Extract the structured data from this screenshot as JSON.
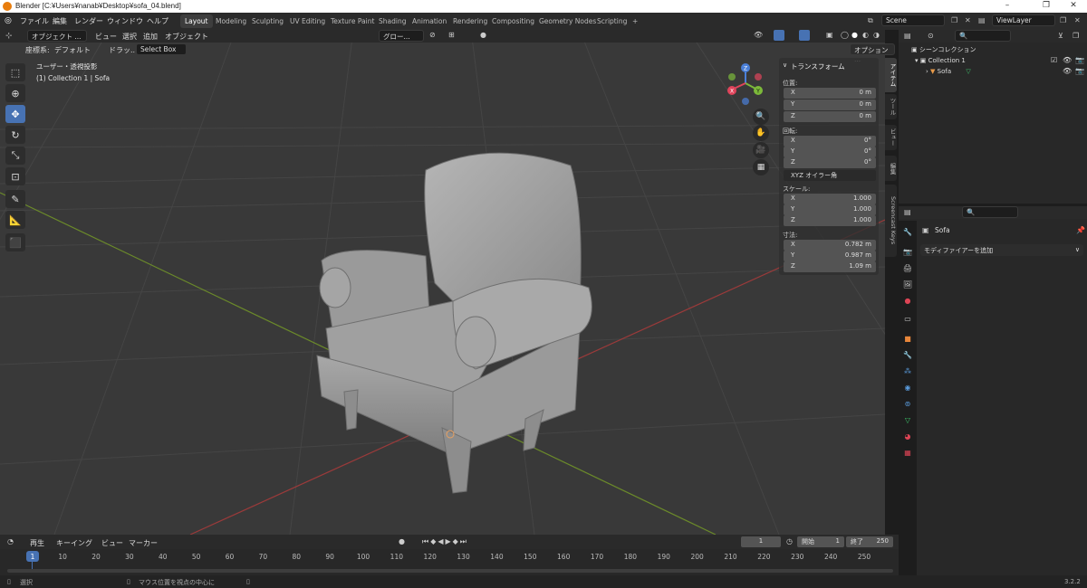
{
  "window": {
    "title": "Blender [C:¥Users¥nanab¥Desktop¥sofa_04.blend]",
    "min": "–",
    "max": "❐",
    "close": "✕"
  },
  "menu": [
    "ファイル",
    "編集",
    "レンダー",
    "ウィンドウ",
    "ヘルプ"
  ],
  "workspaces": [
    "Layout",
    "Modeling",
    "Sculpting",
    "UV Editing",
    "Texture Paint",
    "Shading",
    "Animation",
    "Rendering",
    "Compositing",
    "Geometry Nodes",
    "Scripting"
  ],
  "workspace_add": "+",
  "scene": "Scene",
  "view_layer": "ViewLayer",
  "viewport_header": {
    "mode": "オブジェクト ...",
    "menus": [
      "ビュー",
      "選択",
      "追加",
      "オブジェクト"
    ],
    "orientation": "グロー...",
    "options": "オプション ..."
  },
  "tool_header": {
    "coord_label": "座標系:",
    "coord_value": "デフォルト",
    "drag_label": "ドラッ...",
    "drag_value": "Select Box"
  },
  "overlay": {
    "line1": "ユーザー・透視投影",
    "line2": "(1) Collection 1 | Sofa"
  },
  "gizmo": {
    "x": "X",
    "y": "Y",
    "z": "Z"
  },
  "npanel": {
    "title": "トランスフォーム",
    "loc_label": "位置:",
    "location": [
      {
        "axis": "X",
        "val": "0 m"
      },
      {
        "axis": "Y",
        "val": "0 m"
      },
      {
        "axis": "Z",
        "val": "0 m"
      }
    ],
    "rot_label": "回転:",
    "rotation": [
      {
        "axis": "X",
        "val": "0°"
      },
      {
        "axis": "Y",
        "val": "0°"
      },
      {
        "axis": "Z",
        "val": "0°"
      }
    ],
    "rot_mode": "XYZ オイラー角",
    "scale_label": "スケール:",
    "scale": [
      {
        "axis": "X",
        "val": "1.000"
      },
      {
        "axis": "Y",
        "val": "1.000"
      },
      {
        "axis": "Z",
        "val": "1.000"
      }
    ],
    "dim_label": "寸法:",
    "dimensions": [
      {
        "axis": "X",
        "val": "0.782 m"
      },
      {
        "axis": "Y",
        "val": "0.987 m"
      },
      {
        "axis": "Z",
        "val": "1.09 m"
      }
    ]
  },
  "ntabs": [
    "アイテム",
    "ツール",
    "ビュー",
    "編集",
    "Screencast Keys"
  ],
  "outliner": {
    "root": "シーンコレクション",
    "collection": "Collection 1",
    "object": "Sofa"
  },
  "properties": {
    "object": "Sofa",
    "modifier_btn": "モディファイアーを追加"
  },
  "timeline": {
    "menus": [
      "再生",
      "キーイング",
      "ビュー",
      "マーカー"
    ],
    "current": "1",
    "start_label": "開始",
    "start": "1",
    "end_label": "終了",
    "end": "250",
    "ticks": [
      "1",
      "10",
      "20",
      "30",
      "40",
      "50",
      "60",
      "70",
      "80",
      "90",
      "100",
      "110",
      "120",
      "130",
      "140",
      "150",
      "160",
      "170",
      "180",
      "190",
      "200",
      "210",
      "220",
      "230",
      "240",
      "250"
    ]
  },
  "status": {
    "select": "選択",
    "center": "マウス位置を視点の中心に",
    "version": "3.2.2"
  }
}
